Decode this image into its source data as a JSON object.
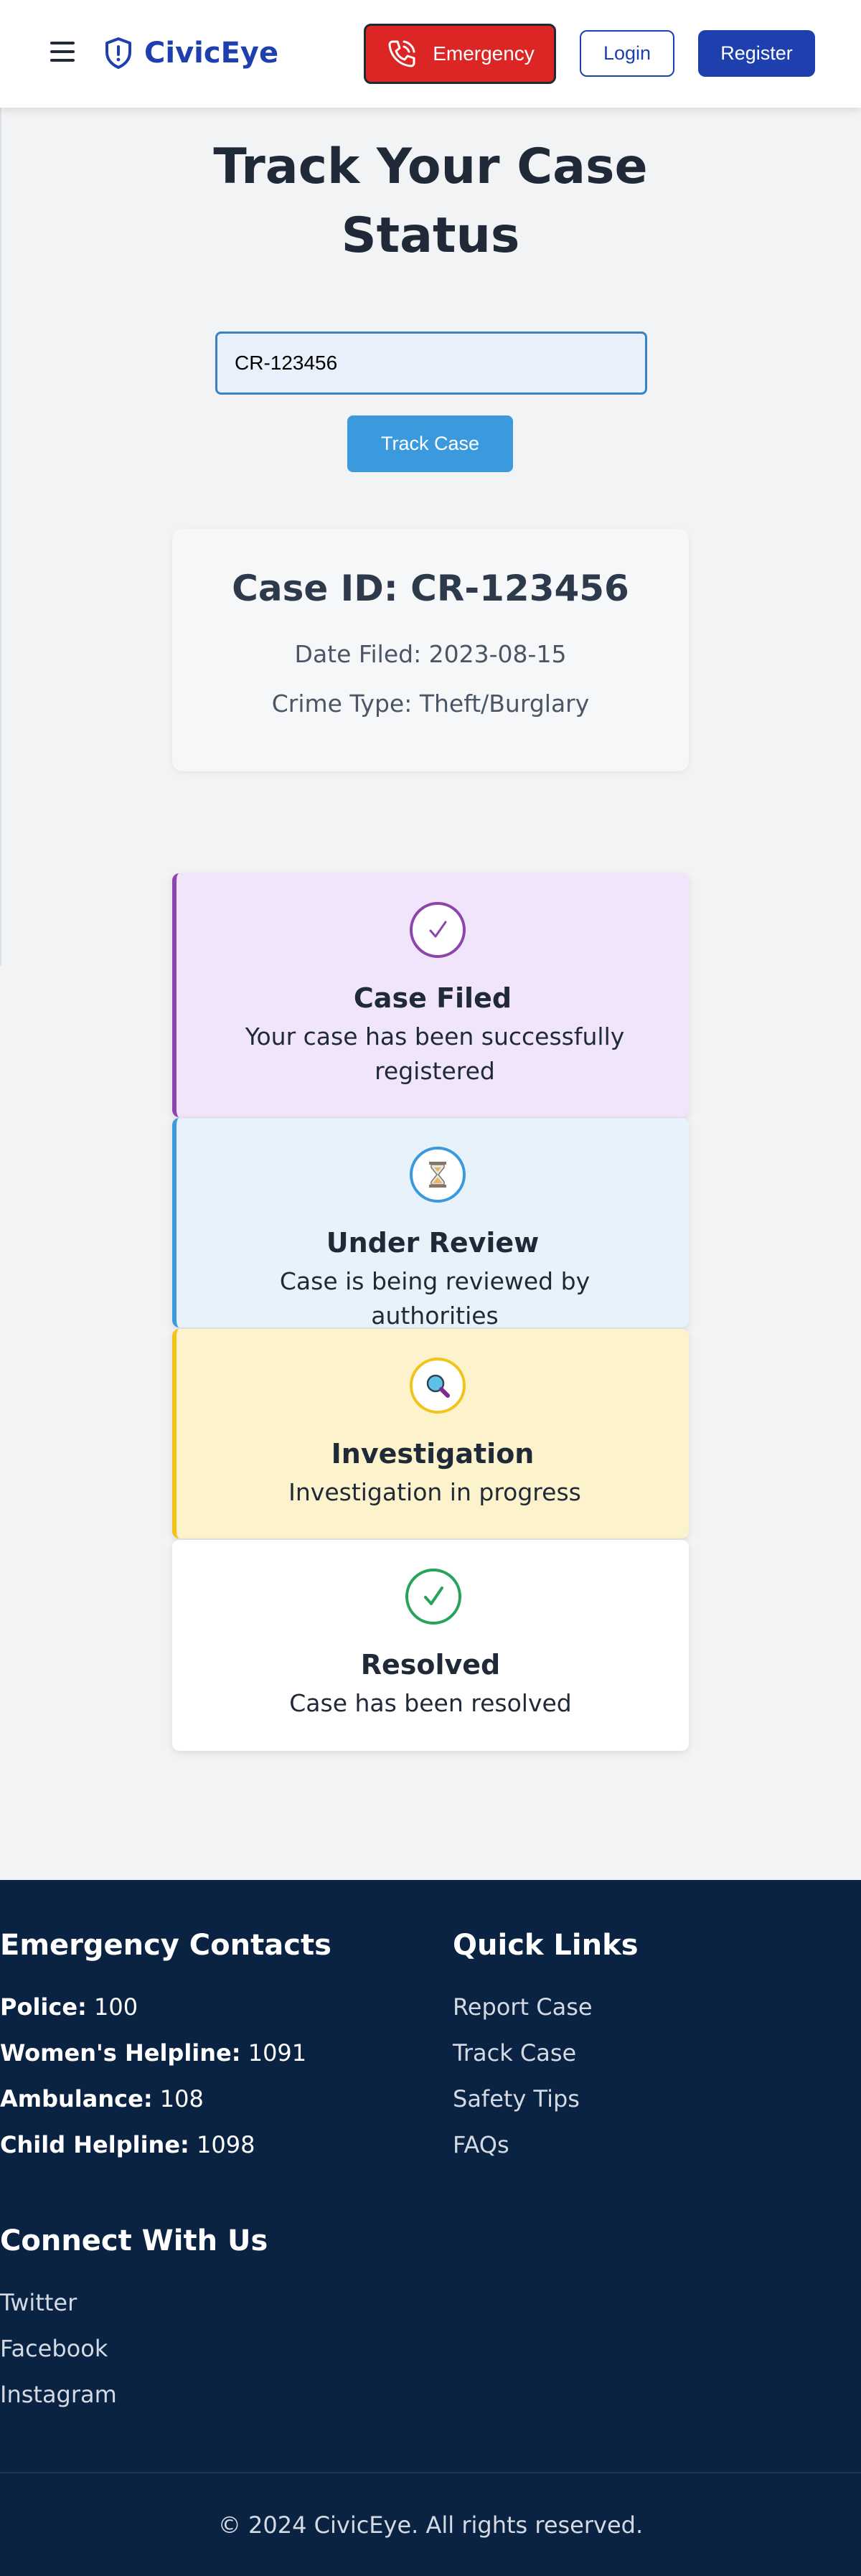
{
  "header": {
    "brand": "CivicEye",
    "emergency_label": "Emergency",
    "login_label": "Login",
    "register_label": "Register"
  },
  "main": {
    "title": "Track Your Case Status",
    "search": {
      "value": "CR-123456"
    },
    "track_button": "Track Case",
    "case": {
      "id_text": "Case ID: CR-123456",
      "date_text": "Date Filed: 2023-08-15",
      "type_text": "Crime Type: Theft/Burglary"
    },
    "timeline": [
      {
        "title": "Case Filed",
        "description": "Your case has been successfully registered",
        "icon": "checkmark-icon",
        "color": "#8e44ad"
      },
      {
        "title": "Under Review",
        "description": "Case is being reviewed by authorities",
        "icon": "hourglass-icon",
        "color": "#3b9ade"
      },
      {
        "title": "Investigation",
        "description": "Investigation in progress",
        "icon": "magnifier-icon",
        "color": "#f0c419"
      },
      {
        "title": "Resolved",
        "description": "Case has been resolved",
        "icon": "check-icon",
        "color": "#27a35a"
      }
    ]
  },
  "footer": {
    "emergency": {
      "heading": "Emergency Contacts",
      "contacts": [
        {
          "label": "Police:",
          "number": "100"
        },
        {
          "label": "Women's Helpline:",
          "number": "1091"
        },
        {
          "label": "Ambulance:",
          "number": "108"
        },
        {
          "label": "Child Helpline:",
          "number": "1098"
        }
      ]
    },
    "quick_links": {
      "heading": "Quick Links",
      "links": [
        "Report Case",
        "Track Case",
        "Safety Tips",
        "FAQs"
      ]
    },
    "connect": {
      "heading": "Connect With Us",
      "links": [
        "Twitter",
        "Facebook",
        "Instagram"
      ]
    },
    "copyright": "© 2024 CivicEye. All rights reserved."
  },
  "colors": {
    "brand": "#1e40af",
    "emergency": "#dc2626",
    "track_button": "#3b9ade",
    "footer_bg": "#0b2342"
  }
}
